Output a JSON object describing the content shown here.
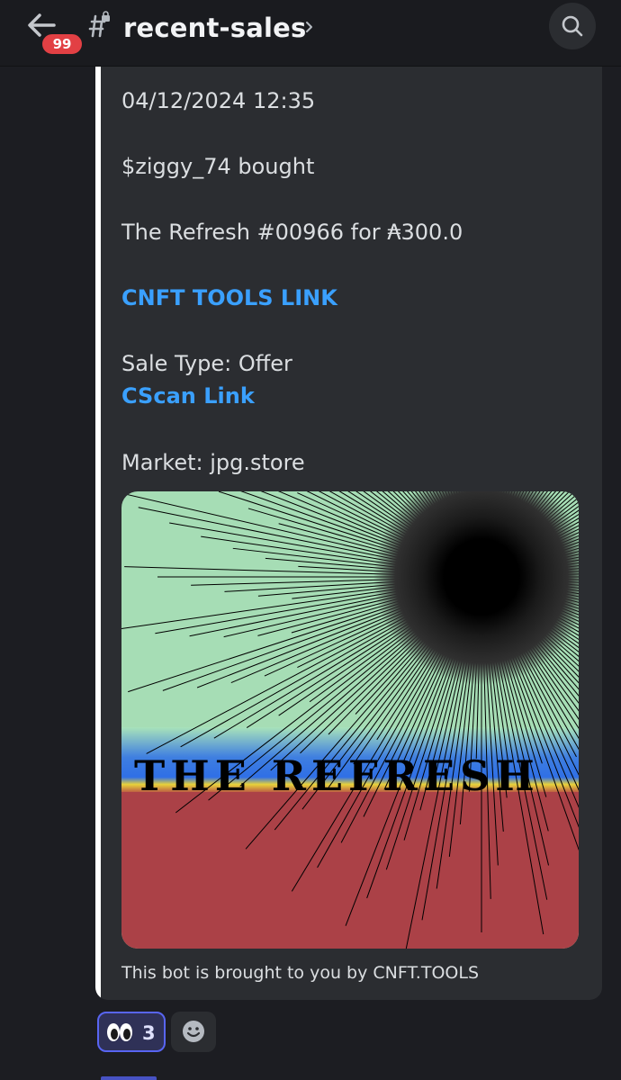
{
  "header": {
    "unread_badge": "99",
    "channel_name": "recent-sales",
    "back_icon": "arrow-left-icon",
    "channel_icon": "locked-hash-icon",
    "search_icon": "search-icon"
  },
  "message": {
    "embed": {
      "accent_color": "#ffffff",
      "timestamp": "04/12/2024 12:35",
      "buyer_line": "$ziggy_74 bought",
      "item_line": "The Refresh #00966 for ₳300.0",
      "cnft_link": "CNFT TOOLS LINK",
      "sale_type": "Sale Type: Offer",
      "cscan_link": "CScan Link",
      "market": "Market: jpg.store",
      "image_title": "THE REFRESH",
      "footer": "This bot is brought to you by CNFT.TOOLS"
    },
    "reactions": [
      {
        "emoji": "eyes-icon",
        "count": "3",
        "selected": true
      }
    ],
    "add_reaction_icon": "add-reaction-smiley-icon"
  },
  "colors": {
    "link": "#3aa0ff",
    "badge": "#e24044",
    "reaction_selected_border": "#5865f2"
  }
}
